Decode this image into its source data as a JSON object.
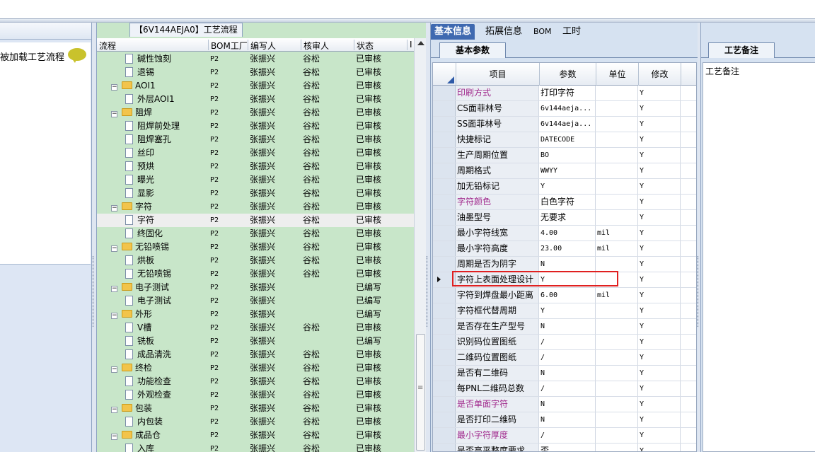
{
  "left_panel": {
    "item_label": "被加载工艺流程"
  },
  "middle": {
    "tab_title": "【6V144AEJA0】工艺流程",
    "columns": [
      "流程",
      "BOM工厂",
      "编写人",
      "核审人",
      "状态",
      "I"
    ],
    "rows": [
      {
        "name": "碱性蚀刻",
        "level": 2,
        "bom": "P2",
        "writer": "张振兴",
        "reviewer": "谷松",
        "status": "已审核"
      },
      {
        "name": "退锡",
        "level": 2,
        "bom": "P2",
        "writer": "张振兴",
        "reviewer": "谷松",
        "status": "已审核"
      },
      {
        "name": "AOI1",
        "level": 1,
        "bom": "P2",
        "writer": "张振兴",
        "reviewer": "谷松",
        "status": "已审核"
      },
      {
        "name": "外层AOI1",
        "level": 2,
        "bom": "P2",
        "writer": "张振兴",
        "reviewer": "谷松",
        "status": "已审核"
      },
      {
        "name": "阻焊",
        "level": 1,
        "bom": "P2",
        "writer": "张振兴",
        "reviewer": "谷松",
        "status": "已审核"
      },
      {
        "name": "阻焊前处理",
        "level": 2,
        "bom": "P2",
        "writer": "张振兴",
        "reviewer": "谷松",
        "status": "已审核"
      },
      {
        "name": "阻焊塞孔",
        "level": 2,
        "bom": "P2",
        "writer": "张振兴",
        "reviewer": "谷松",
        "status": "已审核"
      },
      {
        "name": "丝印",
        "level": 2,
        "bom": "P2",
        "writer": "张振兴",
        "reviewer": "谷松",
        "status": "已审核"
      },
      {
        "name": "预烘",
        "level": 2,
        "bom": "P2",
        "writer": "张振兴",
        "reviewer": "谷松",
        "status": "已审核"
      },
      {
        "name": "曝光",
        "level": 2,
        "bom": "P2",
        "writer": "张振兴",
        "reviewer": "谷松",
        "status": "已审核"
      },
      {
        "name": "显影",
        "level": 2,
        "bom": "P2",
        "writer": "张振兴",
        "reviewer": "谷松",
        "status": "已审核"
      },
      {
        "name": "字符",
        "level": 1,
        "bom": "P2",
        "writer": "张振兴",
        "reviewer": "谷松",
        "status": "已审核"
      },
      {
        "name": "字符",
        "level": 2,
        "bom": "P2",
        "writer": "张振兴",
        "reviewer": "谷松",
        "status": "已审核",
        "selected": true
      },
      {
        "name": "终固化",
        "level": 2,
        "bom": "P2",
        "writer": "张振兴",
        "reviewer": "谷松",
        "status": "已审核"
      },
      {
        "name": "无铅喷锡",
        "level": 1,
        "bom": "P2",
        "writer": "张振兴",
        "reviewer": "谷松",
        "status": "已审核"
      },
      {
        "name": "烘板",
        "level": 2,
        "bom": "P2",
        "writer": "张振兴",
        "reviewer": "谷松",
        "status": "已审核"
      },
      {
        "name": "无铅喷锡",
        "level": 2,
        "bom": "P2",
        "writer": "张振兴",
        "reviewer": "谷松",
        "status": "已审核"
      },
      {
        "name": "电子测试",
        "level": 1,
        "bom": "P2",
        "writer": "张振兴",
        "reviewer": "",
        "status": "已编写"
      },
      {
        "name": "电子测试",
        "level": 2,
        "bom": "P2",
        "writer": "张振兴",
        "reviewer": "",
        "status": "已编写"
      },
      {
        "name": "外形",
        "level": 1,
        "bom": "P2",
        "writer": "张振兴",
        "reviewer": "",
        "status": "已编写"
      },
      {
        "name": "V槽",
        "level": 2,
        "bom": "P2",
        "writer": "张振兴",
        "reviewer": "谷松",
        "status": "已审核"
      },
      {
        "name": "铣板",
        "level": 2,
        "bom": "P2",
        "writer": "张振兴",
        "reviewer": "",
        "status": "已编写"
      },
      {
        "name": "成品清洗",
        "level": 2,
        "bom": "P2",
        "writer": "张振兴",
        "reviewer": "谷松",
        "status": "已审核"
      },
      {
        "name": "终检",
        "level": 1,
        "bom": "P2",
        "writer": "张振兴",
        "reviewer": "谷松",
        "status": "已审核"
      },
      {
        "name": "功能检查",
        "level": 2,
        "bom": "P2",
        "writer": "张振兴",
        "reviewer": "谷松",
        "status": "已审核"
      },
      {
        "name": "外观检查",
        "level": 2,
        "bom": "P2",
        "writer": "张振兴",
        "reviewer": "谷松",
        "status": "已审核"
      },
      {
        "name": "包装",
        "level": 1,
        "bom": "P2",
        "writer": "张振兴",
        "reviewer": "谷松",
        "status": "已审核"
      },
      {
        "name": "内包装",
        "level": 2,
        "bom": "P2",
        "writer": "张振兴",
        "reviewer": "谷松",
        "status": "已审核"
      },
      {
        "name": "成品仓",
        "level": 1,
        "bom": "P2",
        "writer": "张振兴",
        "reviewer": "谷松",
        "status": "已审核"
      },
      {
        "name": "入库",
        "level": 2,
        "bom": "P2",
        "writer": "张振兴",
        "reviewer": "谷松",
        "status": "已审核"
      }
    ]
  },
  "right": {
    "tabs": [
      "基本信息",
      "拓展信息",
      "BOM",
      "工时"
    ],
    "active_tab": 0,
    "subtab": "基本参数",
    "columns": [
      "项目",
      "参数",
      "单位",
      "修改"
    ],
    "rows": [
      {
        "item": "印刷方式",
        "param": "打印字符",
        "unit": "",
        "mod": "Y",
        "hl": true
      },
      {
        "item": "CS面菲林号",
        "param": "6v144aeja...",
        "unit": "",
        "mod": "Y"
      },
      {
        "item": "SS面菲林号",
        "param": "6v144aeja...",
        "unit": "",
        "mod": "Y"
      },
      {
        "item": "快捷标记",
        "param": "DATECODE",
        "unit": "",
        "mod": "Y"
      },
      {
        "item": "生产周期位置",
        "param": "BO",
        "unit": "",
        "mod": "Y"
      },
      {
        "item": "周期格式",
        "param": "WWYY",
        "unit": "",
        "mod": "Y"
      },
      {
        "item": "加无铅标记",
        "param": "Y",
        "unit": "",
        "mod": "Y"
      },
      {
        "item": "字符颜色",
        "param": "白色字符",
        "unit": "",
        "mod": "Y",
        "hl": true
      },
      {
        "item": "油墨型号",
        "param": "无要求",
        "unit": "",
        "mod": "Y"
      },
      {
        "item": "最小字符线宽",
        "param": "4.00",
        "unit": "mil",
        "mod": "Y"
      },
      {
        "item": "最小字符高度",
        "param": "23.00",
        "unit": "mil",
        "mod": "Y"
      },
      {
        "item": "周期是否为阴字",
        "param": "N",
        "unit": "",
        "mod": "Y"
      },
      {
        "item": "字符上表面处理设计",
        "param": "Y",
        "unit": "",
        "mod": "Y",
        "current": true
      },
      {
        "item": "字符到焊盘最小距离",
        "param": "6.00",
        "unit": "mil",
        "mod": "Y"
      },
      {
        "item": "字符框代替周期",
        "param": "Y",
        "unit": "",
        "mod": "Y"
      },
      {
        "item": "是否存在生产型号",
        "param": "N",
        "unit": "",
        "mod": "Y"
      },
      {
        "item": "识别码位置图纸",
        "param": "/",
        "unit": "",
        "mod": "Y"
      },
      {
        "item": "二维码位置图纸",
        "param": "/",
        "unit": "",
        "mod": "Y"
      },
      {
        "item": "是否有二维码",
        "param": "N",
        "unit": "",
        "mod": "Y"
      },
      {
        "item": "每PNL二维码总数",
        "param": "/",
        "unit": "",
        "mod": "Y"
      },
      {
        "item": "是否单面字符",
        "param": "N",
        "unit": "",
        "mod": "Y",
        "hl": true
      },
      {
        "item": "是否打印二维码",
        "param": "N",
        "unit": "",
        "mod": "Y"
      },
      {
        "item": "最小字符厚度",
        "param": "/",
        "unit": "",
        "mod": "Y",
        "hl": true
      },
      {
        "item": "是否高平整度要求",
        "param": "否",
        "unit": "",
        "mod": "Y"
      }
    ]
  },
  "notes": {
    "tab": "工艺备注",
    "label": "工艺备注"
  }
}
